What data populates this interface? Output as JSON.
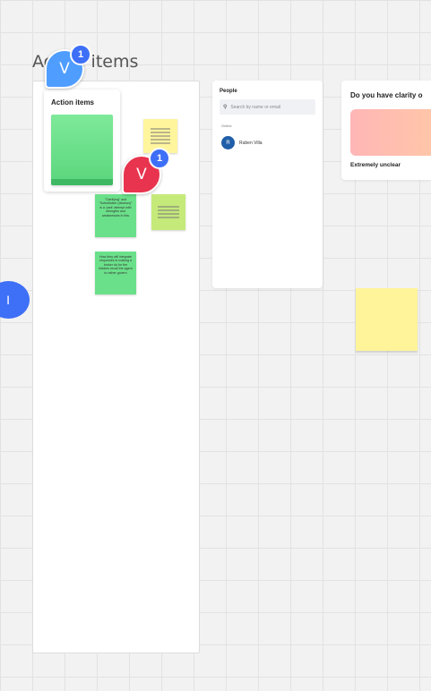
{
  "board": {
    "frame_title": "Action items",
    "card_title": "Action items",
    "stickies": [
      {
        "color": "#fff59d",
        "text": ""
      },
      {
        "color": "#c5ea7a",
        "text": ""
      },
      {
        "color": "#6be08a",
        "text": "\"Clarifying\" and \"Substitution (obvious)\" is a 'park' attempt with strengths and weaknesses in this"
      },
      {
        "color": "#6be08a",
        "text": "How they will integrate responses in making a broker do for the bidders recall the agent to rather govern"
      }
    ]
  },
  "avatars": [
    {
      "initial": "V",
      "color": "#4f9dff",
      "badge": "1"
    },
    {
      "initial": "V",
      "color": "#e8344e",
      "badge": "1"
    }
  ],
  "edge_avatar_initial": "I",
  "people": {
    "title": "People",
    "search_placeholder": "Search by name or email",
    "online_label": "Online",
    "users": [
      {
        "initial": "R",
        "name": "Ruben Villa"
      }
    ]
  },
  "clarity": {
    "question": "Do you have clarity o",
    "label": "Extremely unclear"
  }
}
